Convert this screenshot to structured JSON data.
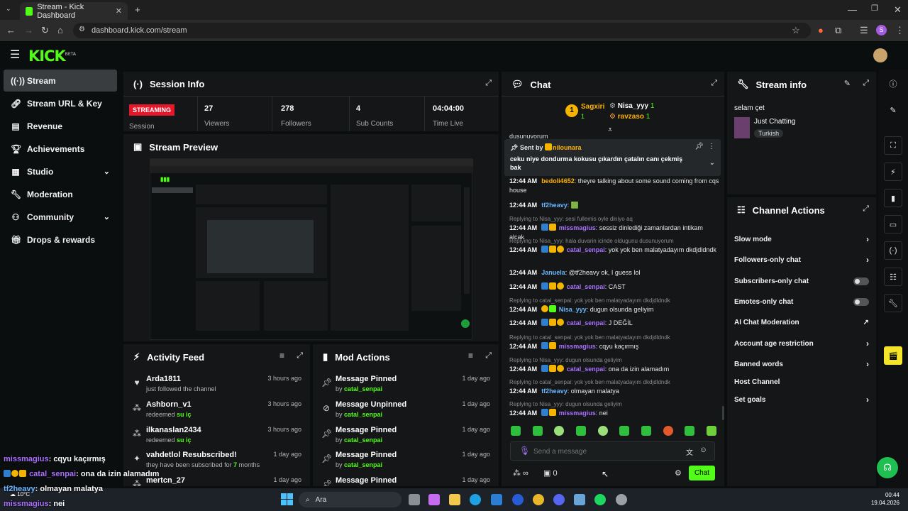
{
  "browser": {
    "tab_title": "Stream - Kick Dashboard",
    "url": "dashboard.kick.com/stream"
  },
  "app": {
    "logo": "KICK",
    "logo_badge": "BETA"
  },
  "sidebar": {
    "items": [
      {
        "label": "Stream",
        "icon": "broadcast-icon"
      },
      {
        "label": "Stream URL & Key",
        "icon": "link-icon"
      },
      {
        "label": "Revenue",
        "icon": "revenue-icon"
      },
      {
        "label": "Achievements",
        "icon": "trophy-icon"
      },
      {
        "label": "Studio",
        "icon": "studio-icon"
      },
      {
        "label": "Moderation",
        "icon": "wrench-icon"
      },
      {
        "label": "Community",
        "icon": "community-icon"
      },
      {
        "label": "Drops & rewards",
        "icon": "gift-icon"
      }
    ]
  },
  "session": {
    "title": "Session Info",
    "status": "STREAMING",
    "status_label": "Session",
    "viewers": "27",
    "viewers_label": "Viewers",
    "followers": "278",
    "followers_label": "Followers",
    "subs": "4",
    "subs_label": "Sub Counts",
    "time": "04:04:00",
    "time_label": "Time Live"
  },
  "preview": {
    "title": "Stream Preview"
  },
  "activity": {
    "title": "Activity Feed",
    "rows": [
      {
        "name": "Arda1811",
        "detail": "just followed the channel",
        "time": "3 hours ago",
        "icon": "heart-icon"
      },
      {
        "name": "Ashborn_v1",
        "detail": "redeemed",
        "reward": "su iç",
        "time": "3 hours ago",
        "icon": "reward-icon"
      },
      {
        "name": "ilkanaslan2434",
        "detail": "redeemed",
        "reward": "su iç",
        "time": "3 hours ago",
        "icon": "reward-icon"
      },
      {
        "name": "vahdetlol Resubscribed!",
        "detail": "they have been subscribed for",
        "months": "7",
        "months_suffix": "months",
        "time": "1 day ago",
        "icon": "sparkle-icon"
      },
      {
        "name": "mertcn_27",
        "detail": "",
        "time": "1 day ago",
        "icon": "reward-icon"
      }
    ]
  },
  "mod": {
    "title": "Mod Actions",
    "rows": [
      {
        "action": "Message Pinned",
        "by": "by",
        "user": "catal_senpai",
        "time": "1 day ago",
        "icon": "pin-icon"
      },
      {
        "action": "Message Unpinned",
        "by": "by",
        "user": "catal_senpai",
        "time": "1 day ago",
        "icon": "unpin-icon"
      },
      {
        "action": "Message Pinned",
        "by": "by",
        "user": "catal_senpai",
        "time": "1 day ago",
        "icon": "pin-icon"
      },
      {
        "action": "Message Pinned",
        "by": "by",
        "user": "catal_senpai",
        "time": "1 day ago",
        "icon": "pin-icon"
      },
      {
        "action": "Message Pinned",
        "by": "by",
        "user": "",
        "time": "1 day ago",
        "icon": "pin-icon"
      }
    ]
  },
  "chat": {
    "title": "Chat",
    "top_gifters": [
      {
        "name": "Sagxiri",
        "count": "1",
        "rank": "1"
      },
      {
        "name": "Nisa_yyy",
        "count": "1"
      },
      {
        "name": "ravzaso",
        "count": "1"
      }
    ],
    "cut_text": "dusunuyorum",
    "pinned": {
      "sent_by": "Sent by",
      "user": "nilounara",
      "text": "ceku niye dondurma kokusu çıkardın çatalın canı çekmiş bak"
    },
    "messages": [
      {
        "time": "12:44 AM",
        "user": "bedoli4652",
        "color": "orange",
        "text": "theyre talking about some sound coming from cqs house"
      },
      {
        "time": "12:44 AM",
        "user": "tf2heavy",
        "color": "blue",
        "text": "🟩"
      },
      {
        "reply": "Replying to Nisa_yyy: sesi fullemis oyle diniyo aq",
        "time": "12:44 AM",
        "user": "missmagius",
        "color": "purple",
        "text": "sessiz dinlediği zamanlardan intikam alcak"
      },
      {
        "reply": "Replying to Nisa_yyy: hala duvarin icinde oldugunu dusunuyorum",
        "time": "12:44 AM",
        "user": "catal_senpai",
        "color": "purple",
        "text": "yok yok ben malatyadayım dkdjdldndk"
      },
      {
        "time": "12:44 AM",
        "user": "Januela",
        "color": "blue",
        "text": "@tf2heavy ok, I guess lol"
      },
      {
        "time": "12:44 AM",
        "user": "catal_senpai",
        "color": "purple",
        "text": "CAST"
      },
      {
        "reply": "Replying to catal_senpai: yok yok ben malatyadayım dkdjdldndk",
        "time": "12:44 AM",
        "user": "Nisa_yyy",
        "color": "blue",
        "text": "dugun olsunda geliyim"
      },
      {
        "time": "12:44 AM",
        "user": "catal_senpai",
        "color": "purple",
        "text": "J DEĞİL"
      },
      {
        "reply": "Replying to catal_senpai: yok yok ben malatyadayım dkdjdldndk",
        "time": "12:44 AM",
        "user": "missmagius",
        "color": "purple",
        "text": "cqyu kaçırmış"
      },
      {
        "reply": "Replying to Nisa_yyy: dugun olsunda geliyim",
        "time": "12:44 AM",
        "user": "catal_senpai",
        "color": "purple",
        "text": "ona da izin alamadım"
      },
      {
        "reply": "Replying to catal_senpai: yok yok ben malatyadayım dkdjdldndk",
        "time": "12:44 AM",
        "user": "tf2heavy",
        "color": "blue",
        "text": "olmayan malatya"
      },
      {
        "reply": "Replying to Nisa_yyy: dugun olsunda geliyim",
        "time": "12:44 AM",
        "user": "missmagius",
        "color": "purple",
        "text": "nei"
      }
    ],
    "input_placeholder": "Send a message",
    "points": "0",
    "send_label": "Chat"
  },
  "stream_info": {
    "title": "Stream info",
    "stream_title": "selam çet",
    "category": "Just Chatting",
    "language": "Turkish"
  },
  "channel_actions": {
    "title": "Channel Actions",
    "rows": [
      {
        "label": "Slow mode",
        "control": "arrow"
      },
      {
        "label": "Followers-only chat",
        "control": "arrow"
      },
      {
        "label": "Subscribers-only chat",
        "control": "toggle"
      },
      {
        "label": "Emotes-only chat",
        "control": "toggle"
      },
      {
        "label": "AI Chat Moderation",
        "control": "external"
      },
      {
        "label": "Account age restriction",
        "control": "arrow"
      },
      {
        "label": "Banned words",
        "control": "arrow"
      },
      {
        "label": "Host Channel",
        "control": "none"
      },
      {
        "label": "Set goals",
        "control": "arrow"
      }
    ]
  },
  "overlay_chat": [
    {
      "user": "missmagius",
      "text": ": cqyu kaçırmış"
    },
    {
      "user": "catal_senpai",
      "text": ": ona da izin alamadım"
    },
    {
      "user": "tf2heavy",
      "text": ": olmayan malatya"
    },
    {
      "user": "missmagius",
      "text": ": nei"
    }
  ],
  "taskbar": {
    "search": "Ara",
    "weather": "10°C",
    "time": "00:44",
    "date": "19.04.2026"
  },
  "colors": {
    "accent": "#53fc18",
    "panel": "#141617",
    "streaming": "#e5172b"
  }
}
